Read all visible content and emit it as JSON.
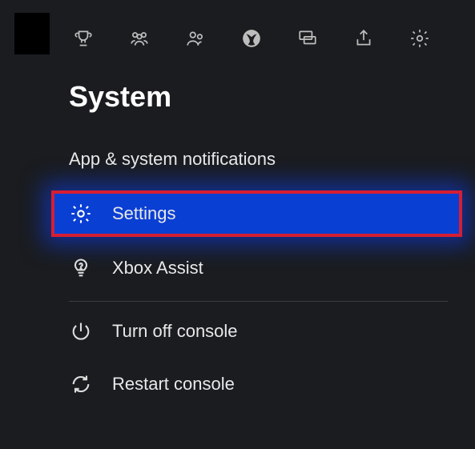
{
  "header": {
    "title": "System"
  },
  "toolbar": {
    "items": [
      {
        "name": "achievements-icon"
      },
      {
        "name": "people-multi-icon"
      },
      {
        "name": "people-icon"
      },
      {
        "name": "xbox-icon"
      },
      {
        "name": "chat-icon"
      },
      {
        "name": "share-icon"
      },
      {
        "name": "settings-gear-icon"
      }
    ]
  },
  "menu": {
    "notification_label": "App & system notifications",
    "settings_label": "Settings",
    "assist_label": "Xbox Assist",
    "turnoff_label": "Turn off console",
    "restart_label": "Restart console"
  }
}
